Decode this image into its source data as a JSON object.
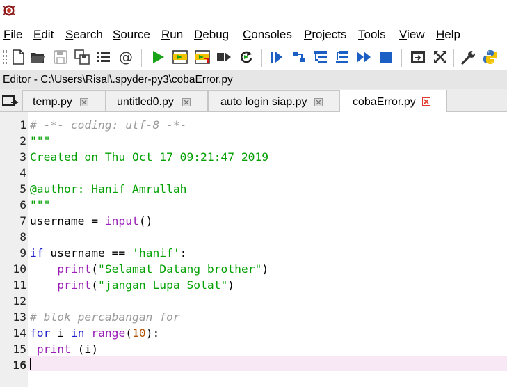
{
  "app": {
    "icon": "spyder-logo-icon"
  },
  "menu": {
    "items": [
      "File",
      "Edit",
      "Search",
      "Source",
      "Run",
      "Debug",
      "Consoles",
      "Projects",
      "Tools",
      "View",
      "Help"
    ]
  },
  "toolbar": {
    "icons": [
      "new-file-icon",
      "open-file-icon",
      "save-icon",
      "save-all-icon",
      "outline-icon",
      "at-sign-icon",
      "run-icon",
      "run-cell-icon",
      "run-cell-advance-icon",
      "run-selection-icon",
      "rerun-icon",
      "debug-icon",
      "step-icon",
      "step-into-icon",
      "step-return-icon",
      "continue-icon",
      "stop-debug-icon",
      "maximize-pane-icon",
      "fullscreen-icon",
      "preferences-wrench-icon",
      "python-path-icon"
    ]
  },
  "editor": {
    "pane_title": "Editor - C:\\Users\\Risal\\.spyder-py3\\cobaError.py",
    "tabs": [
      {
        "label": "temp.py",
        "active": false
      },
      {
        "label": "untitled0.py",
        "active": false
      },
      {
        "label": "auto login siap.py",
        "active": false
      },
      {
        "label": "cobaError.py",
        "active": true
      }
    ],
    "current_line": "16",
    "lines": [
      {
        "n": "1",
        "tokens": [
          {
            "t": "# -*- coding: utf-8 -*-",
            "c": "comment"
          }
        ]
      },
      {
        "n": "2",
        "tokens": [
          {
            "t": "\"\"\"",
            "c": "string"
          }
        ]
      },
      {
        "n": "3",
        "tokens": [
          {
            "t": "Created on Thu Oct 17 09:21:47 2019",
            "c": "string"
          }
        ]
      },
      {
        "n": "4",
        "tokens": []
      },
      {
        "n": "5",
        "tokens": [
          {
            "t": "@author: Hanif Amrullah",
            "c": "string"
          }
        ]
      },
      {
        "n": "6",
        "tokens": [
          {
            "t": "\"\"\"",
            "c": "string"
          }
        ]
      },
      {
        "n": "7",
        "tokens": [
          {
            "t": "username = ",
            "c": "plain"
          },
          {
            "t": "input",
            "c": "builtin"
          },
          {
            "t": "()",
            "c": "plain"
          }
        ]
      },
      {
        "n": "8",
        "tokens": []
      },
      {
        "n": "9",
        "tokens": [
          {
            "t": "if",
            "c": "kw"
          },
          {
            "t": " username == ",
            "c": "plain"
          },
          {
            "t": "'hanif'",
            "c": "string"
          },
          {
            "t": ":",
            "c": "plain"
          }
        ]
      },
      {
        "n": "10",
        "tokens": [
          {
            "t": "    ",
            "c": "plain"
          },
          {
            "t": "print",
            "c": "builtin"
          },
          {
            "t": "(",
            "c": "plain"
          },
          {
            "t": "\"Selamat Datang brother\"",
            "c": "string"
          },
          {
            "t": ")",
            "c": "plain"
          }
        ]
      },
      {
        "n": "11",
        "tokens": [
          {
            "t": "    ",
            "c": "plain"
          },
          {
            "t": "print",
            "c": "builtin"
          },
          {
            "t": "(",
            "c": "plain"
          },
          {
            "t": "\"jangan Lupa Solat\"",
            "c": "string"
          },
          {
            "t": ")",
            "c": "plain"
          }
        ]
      },
      {
        "n": "12",
        "tokens": []
      },
      {
        "n": "13",
        "tokens": [
          {
            "t": "# blok percabangan for",
            "c": "comment"
          }
        ]
      },
      {
        "n": "14",
        "tokens": [
          {
            "t": "for",
            "c": "kw"
          },
          {
            "t": " i ",
            "c": "plain"
          },
          {
            "t": "in",
            "c": "kw"
          },
          {
            "t": " ",
            "c": "plain"
          },
          {
            "t": "range",
            "c": "builtin"
          },
          {
            "t": "(",
            "c": "plain"
          },
          {
            "t": "10",
            "c": "num"
          },
          {
            "t": "):",
            "c": "plain"
          }
        ]
      },
      {
        "n": "15",
        "tokens": [
          {
            "t": " ",
            "c": "plain"
          },
          {
            "t": "print",
            "c": "builtin"
          },
          {
            "t": " (i)",
            "c": "plain"
          }
        ]
      },
      {
        "n": "16",
        "tokens": []
      }
    ]
  },
  "colors": {
    "comment": "#9a9a9a",
    "string": "#00a000",
    "keyword": "#1f1fd0",
    "builtin": "#9b1fb6",
    "number": "#b55200",
    "current_line_bg": "#f8e8f6"
  }
}
